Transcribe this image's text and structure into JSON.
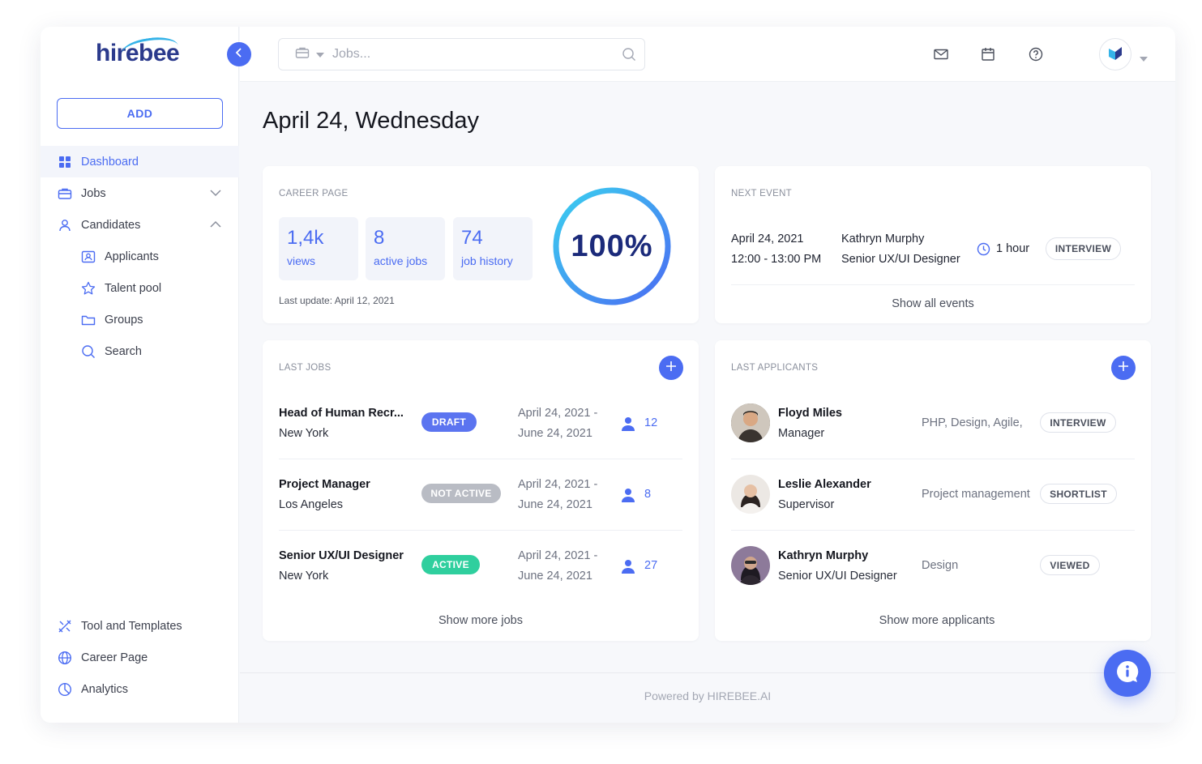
{
  "brand": {
    "name_part1": "hire",
    "name_part2": "bee"
  },
  "sidebar": {
    "add_label": "ADD",
    "items": [
      {
        "label": "Dashboard",
        "icon": "grid-icon"
      },
      {
        "label": "Jobs",
        "icon": "briefcase-icon"
      },
      {
        "label": "Candidates",
        "icon": "user-icon"
      },
      {
        "label": "Applicants",
        "icon": "id-card-icon"
      },
      {
        "label": "Talent pool",
        "icon": "star-icon"
      },
      {
        "label": "Groups",
        "icon": "folder-icon"
      },
      {
        "label": "Search",
        "icon": "search-icon"
      }
    ],
    "bottom_items": [
      {
        "label": "Tool and Templates",
        "icon": "tools-icon"
      },
      {
        "label": "Career Page",
        "icon": "globe-icon"
      },
      {
        "label": "Analytics",
        "icon": "pie-chart-icon"
      }
    ]
  },
  "search": {
    "placeholder": "Jobs..."
  },
  "page_title": "April 24, Wednesday",
  "career_page": {
    "label": "CAREER PAGE",
    "stats": [
      {
        "value": "1,4k",
        "label": "views"
      },
      {
        "value": "8",
        "label": "active jobs"
      },
      {
        "value": "74",
        "label": "job history"
      }
    ],
    "last_update": "Last update: April 12, 2021",
    "progress_text": "100%",
    "progress_fraction": 1.0
  },
  "next_event": {
    "label": "NEXT EVENT",
    "date": "April 24, 2021",
    "time": "12:00 - 13:00 PM",
    "person": "Kathryn Murphy",
    "role": "Senior UX/UI Designer",
    "duration": "1 hour",
    "type": "INTERVIEW",
    "show_all": "Show all events"
  },
  "last_jobs": {
    "label": "LAST JOBS",
    "rows": [
      {
        "title": "Head of Human Recr...",
        "location": "New York",
        "status": "DRAFT",
        "status_color": "#5b74f0",
        "date_from": "April 24, 2021 -",
        "date_to": "June 24, 2021",
        "count": "12"
      },
      {
        "title": "Project Manager",
        "location": "Los Angeles",
        "status": "NOT ACTIVE",
        "status_color": "#b9bcc4",
        "date_from": "April 24, 2021 -",
        "date_to": "June 24, 2021",
        "count": "8"
      },
      {
        "title": "Senior UX/UI Designer",
        "location": "New York",
        "status": "ACTIVE",
        "status_color": "#2fcf9e",
        "date_from": "April 24, 2021 -",
        "date_to": "June 24, 2021",
        "count": "27"
      }
    ],
    "show_more": "Show more jobs"
  },
  "last_applicants": {
    "label": "LAST APPLICANTS",
    "rows": [
      {
        "name": "Floyd Miles",
        "role": "Manager",
        "skills": "PHP, Design, Agile,",
        "status": "INTERVIEW"
      },
      {
        "name": "Leslie Alexander",
        "role": "Supervisor",
        "skills": "Project management",
        "status": "SHORTLIST"
      },
      {
        "name": "Kathryn Murphy",
        "role": "Senior UX/UI Designer",
        "skills": "Design",
        "status": "VIEWED"
      }
    ],
    "show_more": "Show more applicants"
  },
  "footer": "Powered by HIREBEE.AI",
  "colors": {
    "accent": "#4b6cf2",
    "ring_start": "#3ad0f0",
    "ring_end": "#4b6cf2"
  }
}
